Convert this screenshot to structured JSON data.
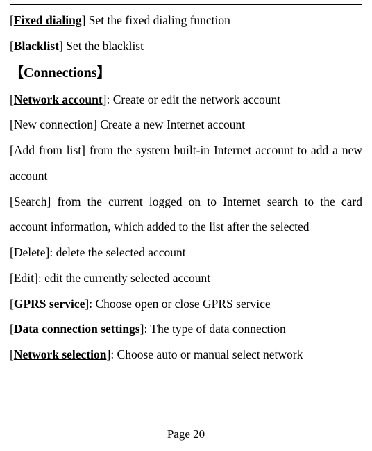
{
  "entries": {
    "fixed_dialing": {
      "label": "Fixed dialing",
      "desc": " Set the fixed dialing function"
    },
    "blacklist": {
      "label": "Blacklist",
      "desc": " Set the blacklist"
    },
    "section": {
      "open": "【",
      "title": "Connections",
      "close": "】"
    },
    "network_account": {
      "label": "Network account",
      "desc": ": Create or edit the network account"
    },
    "new_connection": {
      "label": "New connection",
      "desc": " Create a new Internet account"
    },
    "add_from_list": {
      "label": "Add from list",
      "desc": " from the system built-in Internet account to add a new account"
    },
    "search": {
      "label": "Search",
      "desc": " from the current logged on to Internet search to the card account information, which added to the list after the selected"
    },
    "delete": {
      "label": "Delete",
      "desc": ": delete the selected account"
    },
    "edit": {
      "label": "Edit",
      "desc": ": edit the currently selected account"
    },
    "gprs": {
      "label": "GPRS service",
      "desc": ": Choose open or close GPRS service"
    },
    "data_conn": {
      "label": "Data connection settings",
      "desc": ": The type of data connection"
    },
    "net_sel": {
      "label": "Network selection",
      "desc": ": Choose auto or manual select network"
    }
  },
  "footer": "Page 20",
  "b": {
    "open": "[",
    "close": "]"
  }
}
